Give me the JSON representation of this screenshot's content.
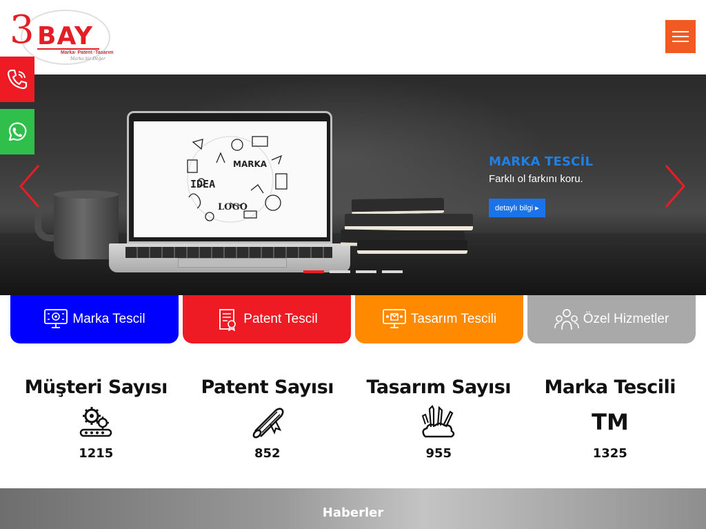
{
  "header": {
    "logo_mark": "3",
    "logo_word": "BAY",
    "logo_subtitle": "Marka· Patent ·Tasarım",
    "logo_tagline": "Marka bir Değer"
  },
  "contact": {
    "phone_icon": "phone-icon",
    "whatsapp_icon": "whatsapp-icon",
    "phone_color": "#ee1b24",
    "whatsapp_color": "#2fbf4a"
  },
  "menu": {
    "icon": "hamburger-icon",
    "color": "#f15a22"
  },
  "slider": {
    "title": "MARKA TESCİL",
    "text": "Farklı ol farkını koru.",
    "button_label": "detaylı bilgi ▸",
    "screen_words": {
      "marka": "MARKA",
      "idea": "IDEA",
      "logo": "LOGO"
    },
    "active_slide": 1,
    "slide_count": 4
  },
  "services": [
    {
      "label": "Marka Tescil",
      "color": "#0000ff",
      "icon": "monitor-gear-icon"
    },
    {
      "label": "Patent Tescil",
      "color": "#ee1b24",
      "icon": "certificate-icon"
    },
    {
      "label": "Tasarım Tescili",
      "color": "#ff8a00",
      "icon": "design-screen-icon"
    },
    {
      "label": "Özel Hizmetler",
      "color": "#a9a9a9",
      "icon": "team-network-icon"
    }
  ],
  "stats": [
    {
      "title": "Müşteri Sayısı",
      "value": "1215",
      "icon": "gears-conveyor-icon"
    },
    {
      "title": "Patent Sayısı",
      "value": "852",
      "icon": "diploma-scroll-icon"
    },
    {
      "title": "Tasarım Sayısı",
      "value": "955",
      "icon": "art-tools-icon"
    },
    {
      "title": "Marka Tescili",
      "value": "1325",
      "icon": "trademark-icon"
    }
  ],
  "stats_trademark_glyph": "TM",
  "news": {
    "title": "Haberler"
  }
}
